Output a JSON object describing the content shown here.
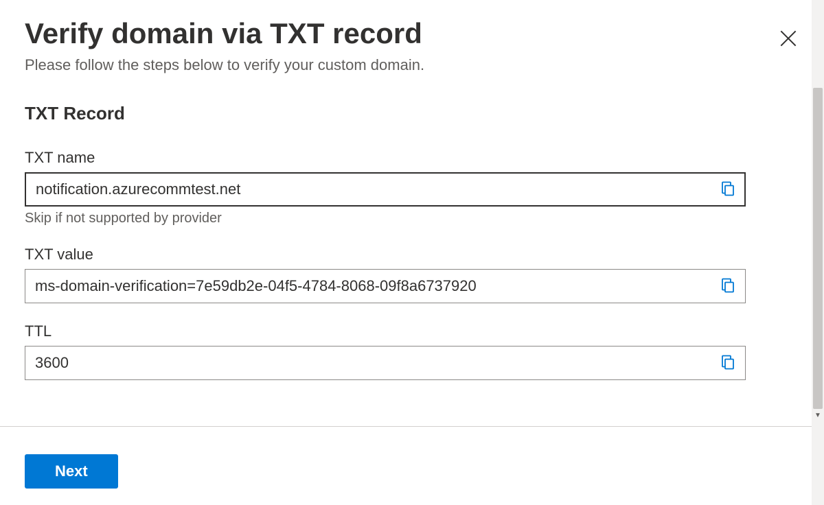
{
  "header": {
    "title": "Verify domain via TXT record",
    "subtitle": "Please follow the steps below to verify your custom domain."
  },
  "section": {
    "title": "TXT Record"
  },
  "fields": {
    "txtName": {
      "label": "TXT name",
      "value": "notification.azurecommtest.net",
      "helper": "Skip if not supported by provider"
    },
    "txtValue": {
      "label": "TXT value",
      "value": "ms-domain-verification=7e59db2e-04f5-4784-8068-09f8a6737920"
    },
    "ttl": {
      "label": "TTL",
      "value": "3600"
    }
  },
  "buttons": {
    "next": "Next"
  },
  "colors": {
    "primary": "#0078d4",
    "text": "#323130",
    "textSecondary": "#605e5c",
    "border": "#8a8886"
  }
}
